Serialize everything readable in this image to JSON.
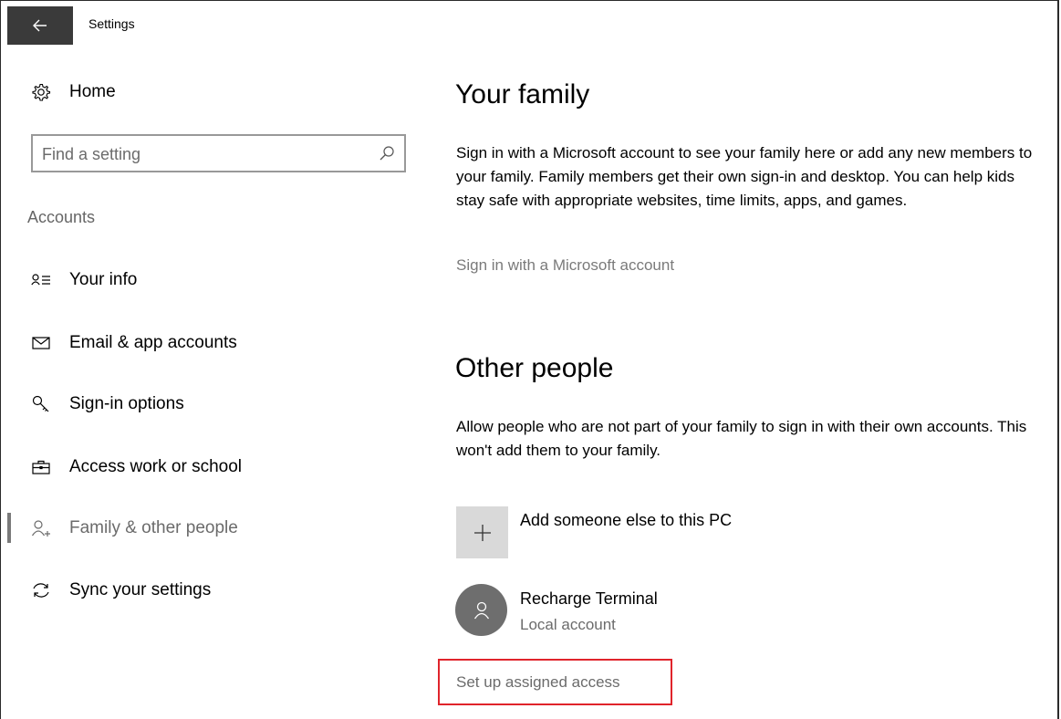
{
  "window": {
    "title": "Settings"
  },
  "sidebar": {
    "home_label": "Home",
    "search_placeholder": "Find a setting",
    "section_label": "Accounts",
    "items": [
      {
        "label": "Your info",
        "icon": "person-card-icon"
      },
      {
        "label": "Email & app accounts",
        "icon": "envelope-icon"
      },
      {
        "label": "Sign-in options",
        "icon": "key-icon"
      },
      {
        "label": "Access work or school",
        "icon": "briefcase-icon"
      },
      {
        "label": "Family & other people",
        "icon": "add-person-icon",
        "selected": true
      },
      {
        "label": "Sync your settings",
        "icon": "sync-icon"
      }
    ]
  },
  "main": {
    "family": {
      "heading": "Your family",
      "description": "Sign in with a Microsoft account to see your family here or add any new members to your family. Family members get their own sign-in and desktop. You can help kids stay safe with appropriate websites, time limits, apps, and games.",
      "link": "Sign in with a Microsoft account"
    },
    "other_people": {
      "heading": "Other people",
      "description": "Allow people who are not part of your family to sign in with their own accounts. This won't add them to your family.",
      "add_label": "Add someone else to this PC",
      "users": [
        {
          "name": "Recharge Terminal",
          "type": "Local account"
        }
      ],
      "assigned_access_link": "Set up assigned access"
    }
  },
  "colors": {
    "highlight_box": "#e0242b",
    "back_button_bg": "#3a3a3a",
    "link_gray": "#7a7a7a"
  }
}
